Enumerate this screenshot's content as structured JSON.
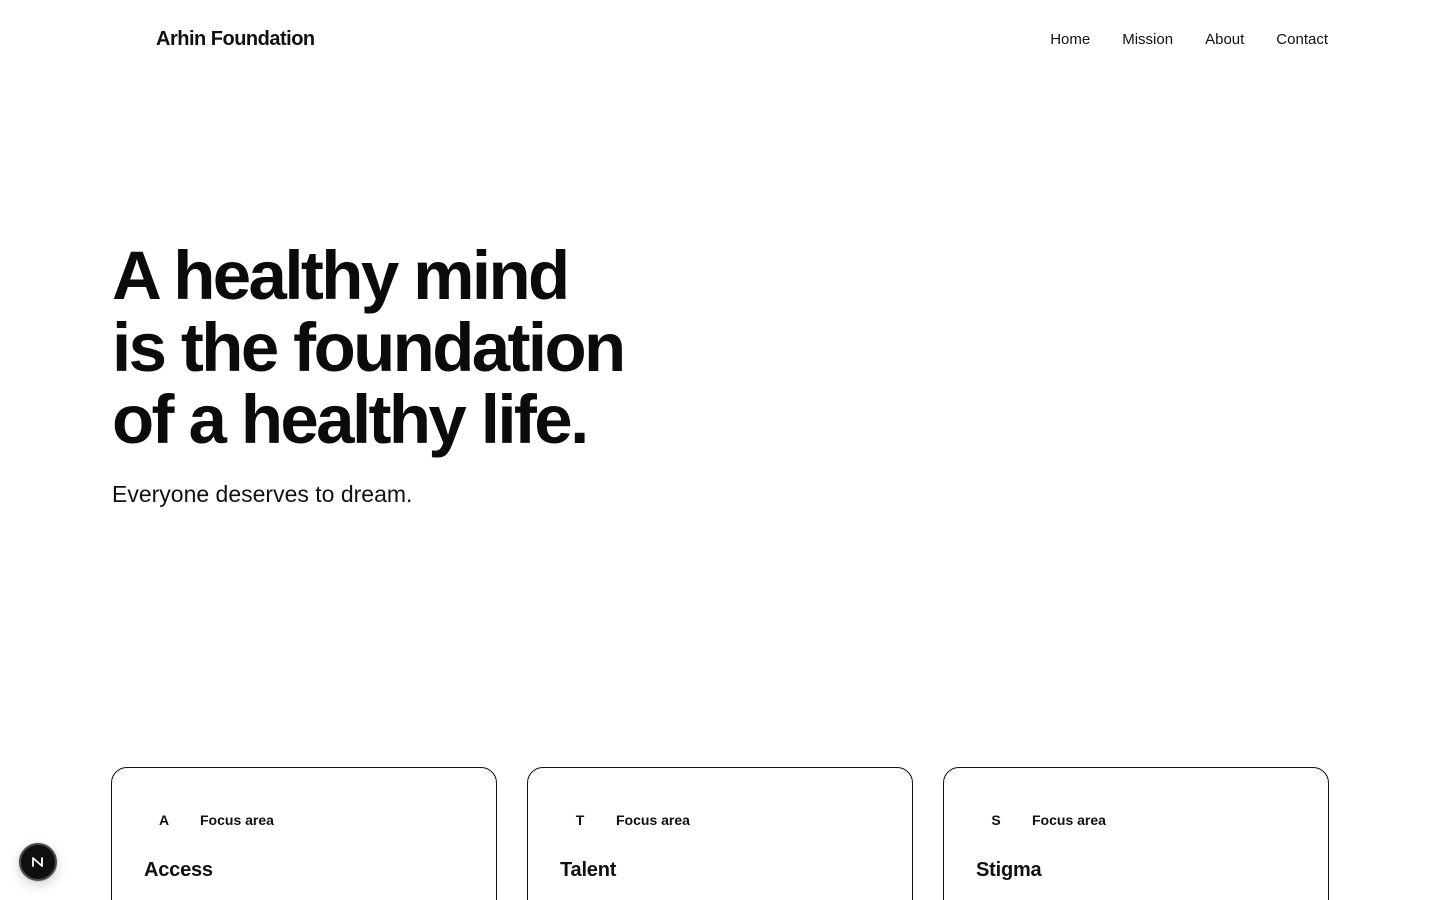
{
  "header": {
    "brand": "Arhin Foundation",
    "nav": [
      "Home",
      "Mission",
      "About",
      "Contact"
    ]
  },
  "hero": {
    "title_lines": [
      "A healthy mind",
      "is the foundation",
      "of a healthy life."
    ],
    "subtitle": "Everyone deserves to dream."
  },
  "focus_cards": [
    {
      "letter": "A",
      "meta": "Focus area",
      "title": "Access"
    },
    {
      "letter": "T",
      "meta": "Focus area",
      "title": "Talent"
    },
    {
      "letter": "S",
      "meta": "Focus area",
      "title": "Stigma"
    }
  ],
  "floating_badge": {
    "icon": "n-logo-icon"
  }
}
